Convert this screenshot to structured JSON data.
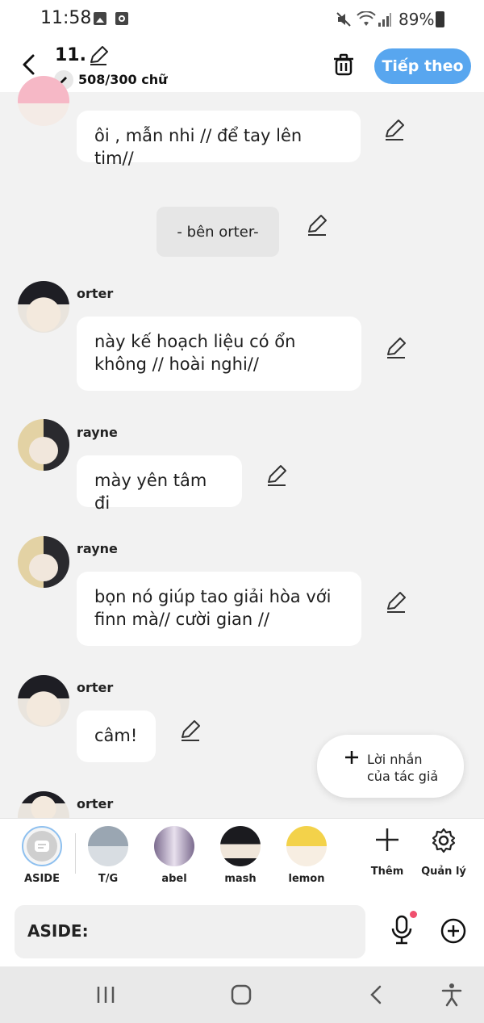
{
  "status_bar": {
    "time": "11:58",
    "battery": "89%"
  },
  "header": {
    "chapter_title": "11.",
    "word_count": "508/300 chữ",
    "next_label": "Tiếp theo"
  },
  "messages": [
    {
      "type": "character",
      "name": "",
      "text": "ôi , mẫn nhi // để tay lên tim//"
    },
    {
      "type": "narration",
      "text": "- bên orter-"
    },
    {
      "type": "character",
      "name": "orter",
      "text": "này kế hoạch liệu có ổn không // hoài nghi//"
    },
    {
      "type": "character",
      "name": "rayne",
      "text": "mày yên tâm đi"
    },
    {
      "type": "character",
      "name": "rayne",
      "text": "bọn nó giúp tao giải hòa với finn mà// cười gian //"
    },
    {
      "type": "character",
      "name": "orter",
      "text": "câm!"
    },
    {
      "type": "character",
      "name": "orter",
      "text": ""
    }
  ],
  "author_note_button": {
    "line1": "Lời nhắn",
    "line2": "của tác giả"
  },
  "character_bar": {
    "items": [
      {
        "label": "ASIDE"
      },
      {
        "label": "T/G"
      },
      {
        "label": "abel"
      },
      {
        "label": "mash"
      },
      {
        "label": "lemon"
      }
    ],
    "add_label": "Thêm",
    "manage_label": "Quản lý"
  },
  "input": {
    "placeholder": "ASIDE:"
  },
  "colors": {
    "accent": "#58a6ef",
    "background": "#f2f2f2",
    "bubble": "#ffffff",
    "notification_dot": "#f0506e"
  }
}
